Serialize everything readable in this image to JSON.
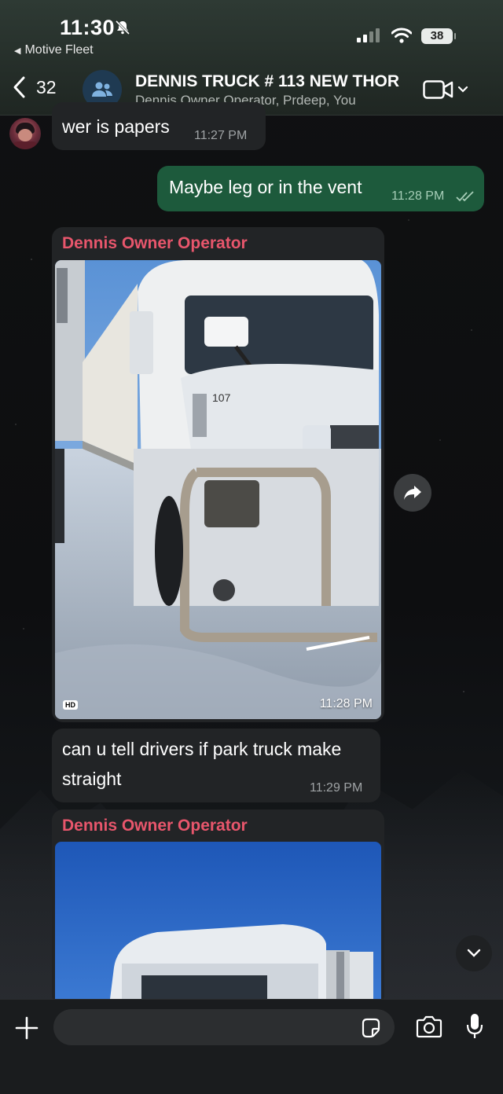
{
  "status_bar": {
    "time": "11:30",
    "back_app": "Motive Fleet",
    "battery": "38"
  },
  "header": {
    "back_count": "32",
    "title": "DENNIS TRUCK # 113 NEW THOR",
    "subtitle": "Dennis Owner Operator, Prdeep, You"
  },
  "messages": [
    {
      "type": "text",
      "direction": "in",
      "text": "wer is papers",
      "time": "11:27 PM"
    },
    {
      "type": "text",
      "direction": "out",
      "text": "Maybe leg or in the vent",
      "time": "11:28 PM"
    },
    {
      "type": "image",
      "direction": "in",
      "sender": "Dennis Owner Operator",
      "badge": "HD",
      "time": "11:28 PM",
      "truck_number": "107"
    },
    {
      "type": "text",
      "direction": "in",
      "text_line1": "can u tell drivers if park truck make",
      "text_line2": "straight",
      "time": "11:29 PM"
    },
    {
      "type": "image",
      "direction": "in",
      "sender": "Dennis Owner Operator"
    }
  ],
  "icons": {
    "bell": "bell-slash-icon",
    "back": "chevron-left-icon",
    "group": "group-icon",
    "video": "video-camera-icon",
    "forward": "forward-icon",
    "scroll": "chevron-down-icon",
    "plus": "plus-icon",
    "sticker": "sticker-icon",
    "camera": "camera-icon",
    "mic": "microphone-icon"
  },
  "colors": {
    "outgoing_bubble": "#1d5a3c",
    "incoming_bubble": "#222426",
    "sender_name": "#e8566c"
  }
}
